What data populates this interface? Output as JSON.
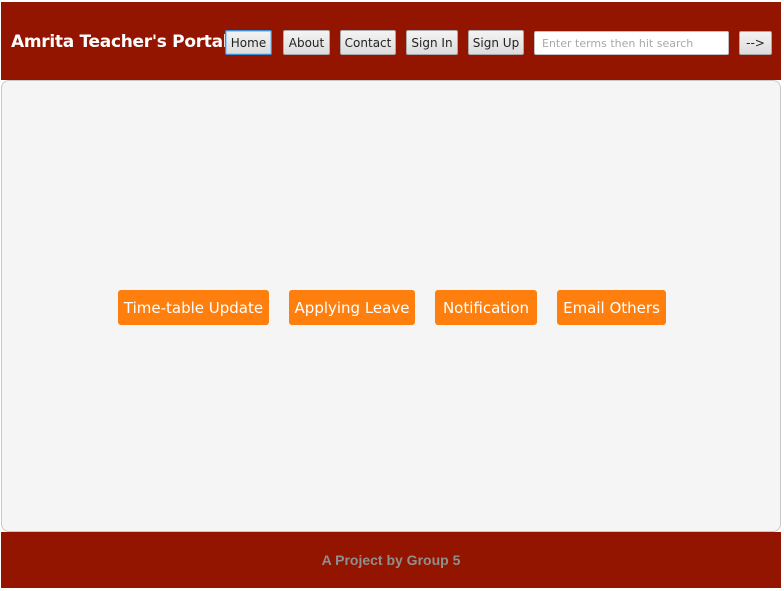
{
  "header": {
    "brand": "Amrita Teacher's Portal",
    "nav": {
      "home": "Home",
      "about": "About",
      "contact": "Contact",
      "sign_in": "Sign In",
      "sign_up": "Sign Up"
    },
    "search": {
      "value": "",
      "placeholder": "Enter terms then hit search",
      "submit_label": "-->"
    }
  },
  "main": {
    "actions": {
      "timetable": "Time-table Update",
      "leave": "Applying Leave",
      "notification": "Notification",
      "email": "Email Others"
    }
  },
  "footer": {
    "text": "A Project by Group 5"
  },
  "colors": {
    "header_bg": "#931500",
    "accent": "#ff7f0e",
    "content_bg": "#f5f5f5"
  }
}
